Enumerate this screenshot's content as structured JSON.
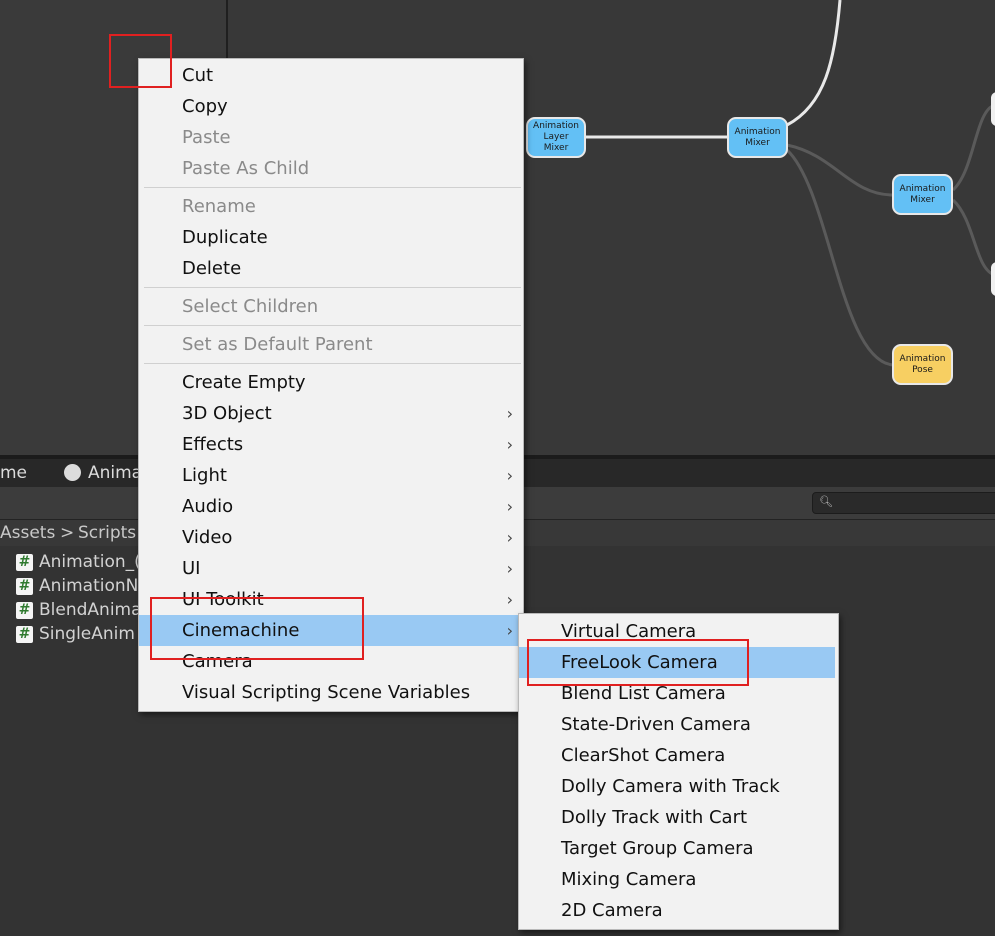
{
  "graph": {
    "nodes": [
      {
        "id": "layer-mixer",
        "lines": [
          "Animation",
          "Layer",
          "Mixer"
        ],
        "color": "blue"
      },
      {
        "id": "mixer-1",
        "lines": [
          "Animation",
          "Mixer"
        ],
        "color": "blue"
      },
      {
        "id": "mixer-2",
        "lines": [
          "Animation",
          "Mixer"
        ],
        "color": "blue"
      },
      {
        "id": "pose",
        "lines": [
          "Animation",
          "Pose"
        ],
        "color": "yellow"
      }
    ]
  },
  "tabs": {
    "left_partial": "me",
    "animator": "Anima"
  },
  "breadcrumb": {
    "assets": "Assets",
    "separator": ">",
    "scripts": "Scripts"
  },
  "files": [
    "Animation_(",
    "AnimationN",
    "BlendAnima",
    "SingleAnim"
  ],
  "context_menu": {
    "items": [
      {
        "label": "Cut",
        "disabled": false
      },
      {
        "label": "Copy",
        "disabled": false
      },
      {
        "label": "Paste",
        "disabled": true
      },
      {
        "label": "Paste As Child",
        "disabled": true
      },
      {
        "label": "Rename",
        "disabled": true
      },
      {
        "label": "Duplicate",
        "disabled": false
      },
      {
        "label": "Delete",
        "disabled": false
      },
      {
        "label": "Select Children",
        "disabled": true
      },
      {
        "label": "Set as Default Parent",
        "disabled": true
      },
      {
        "label": "Create Empty",
        "disabled": false
      },
      {
        "label": "3D Object",
        "disabled": false,
        "submenu": true
      },
      {
        "label": "Effects",
        "disabled": false,
        "submenu": true
      },
      {
        "label": "Light",
        "disabled": false,
        "submenu": true
      },
      {
        "label": "Audio",
        "disabled": false,
        "submenu": true
      },
      {
        "label": "Video",
        "disabled": false,
        "submenu": true
      },
      {
        "label": "UI",
        "disabled": false,
        "submenu": true
      },
      {
        "label": "UI Toolkit",
        "disabled": false,
        "submenu": true
      },
      {
        "label": "Cinemachine",
        "disabled": false,
        "submenu": true,
        "highlighted": true
      },
      {
        "label": "Camera",
        "disabled": false
      },
      {
        "label": "Visual Scripting Scene Variables",
        "disabled": false
      }
    ],
    "submenu_glyph": "›"
  },
  "cinemachine_submenu": {
    "items": [
      {
        "label": "Virtual Camera"
      },
      {
        "label": "FreeLook Camera",
        "highlighted": true
      },
      {
        "label": "Blend List Camera"
      },
      {
        "label": "State-Driven Camera"
      },
      {
        "label": "ClearShot Camera"
      },
      {
        "label": "Dolly Camera with Track"
      },
      {
        "label": "Dolly Track with Cart"
      },
      {
        "label": "Target Group Camera"
      },
      {
        "label": "Mixing Camera"
      },
      {
        "label": "2D Camera"
      }
    ]
  },
  "colors": {
    "highlight": "#99c9f3",
    "annotation": "#e02020",
    "node_blue": "#63c0f5",
    "node_yellow": "#f7cf62"
  }
}
